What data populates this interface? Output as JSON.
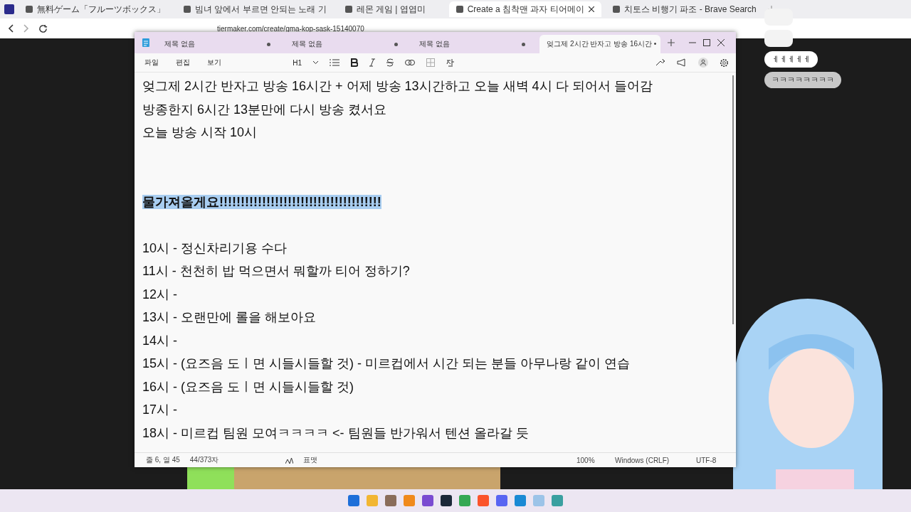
{
  "browser": {
    "tabs": [
      {
        "title": "無料ゲーム「フルーツボックス」",
        "selected": false
      },
      {
        "title": "빔녀 앞에서 부르면 안되는 노래 기",
        "selected": false
      },
      {
        "title": "레몬 게임 | 엽엽미",
        "selected": false
      },
      {
        "title": "Create a 침착맨 과자 티어메이",
        "selected": true
      },
      {
        "title": "치토스 비행기 파조 - Brave Search",
        "selected": false
      }
    ],
    "url": "tiermaker.com/create/gma-kop-sask-15140070"
  },
  "notepad": {
    "tabs": [
      {
        "title": "제목 없음",
        "selected": false
      },
      {
        "title": "제목 없음",
        "selected": false
      },
      {
        "title": "제목 없음",
        "selected": false
      },
      {
        "title": "엊그제 2시간 반자고 방송 16시간 •",
        "selected": true
      }
    ],
    "menus": [
      "파일",
      "편집",
      "보기"
    ],
    "heading_button": "H1",
    "lines": [
      {
        "kind": "text",
        "text": "엊그제 2시간 반자고 방송 16시간 + 어제 방송 13시간하고 오늘 새벽 4시 다 되어서 들어감",
        "selected": false
      },
      {
        "kind": "text",
        "text": "방종한지 6시간 13분만에 다시 방송 켰서요",
        "selected": false
      },
      {
        "kind": "text",
        "text": "오늘 방송 시작 10시",
        "selected": false
      },
      {
        "kind": "blank"
      },
      {
        "kind": "blank"
      },
      {
        "kind": "text",
        "text": "물가져올게요!!!!!!!!!!!!!!!!!!!!!!!!!!!!!!!!!!!!!!",
        "selected": true
      },
      {
        "kind": "blank"
      },
      {
        "kind": "text",
        "text": "10시 - 정신차리기용 수다",
        "selected": false
      },
      {
        "kind": "text",
        "text": "11시 - 천천히 밥 먹으면서 뭐할까 티어 정하기?",
        "selected": false
      },
      {
        "kind": "text",
        "text": "12시 -",
        "selected": false
      },
      {
        "kind": "text",
        "text": "13시 - 오랜만에 롤을 해보아요",
        "selected": false
      },
      {
        "kind": "text",
        "text": "14시 -",
        "selected": false
      },
      {
        "kind": "text",
        "text": "15시 - (요즈음 도ㅣ면 시들시들할 것)  - 미르컵에서 시간 되는 분들 아무나랑 같이 연습",
        "selected": false
      },
      {
        "kind": "text",
        "text": "16시 - (요즈음 도ㅣ면 시들시들할 것)",
        "selected": false
      },
      {
        "kind": "text",
        "text": "17시 -",
        "selected": false
      },
      {
        "kind": "text",
        "text": "18시 - 미르컵 팀원 모여ㅋㅋㅋㅋ  <- 팀원들 반가워서 텐션 올라갈 듯",
        "selected": false
      }
    ],
    "status": {
      "position": "줄 6, 열 45",
      "count": "44/373자",
      "format": "표맷",
      "zoom": "100%",
      "line_ending": "Windows (CRLF)",
      "encoding": "UTF-8"
    }
  },
  "chat": [
    {
      "kind": "sticker"
    },
    {
      "kind": "sticker"
    },
    {
      "kind": "text",
      "text": "ㅔㅔㅔㅔㅔ",
      "highlighted": false
    },
    {
      "kind": "text",
      "text": "ㅋㅋㅋㅋㅋㅋㅋㅋ",
      "highlighted": true
    }
  ]
}
